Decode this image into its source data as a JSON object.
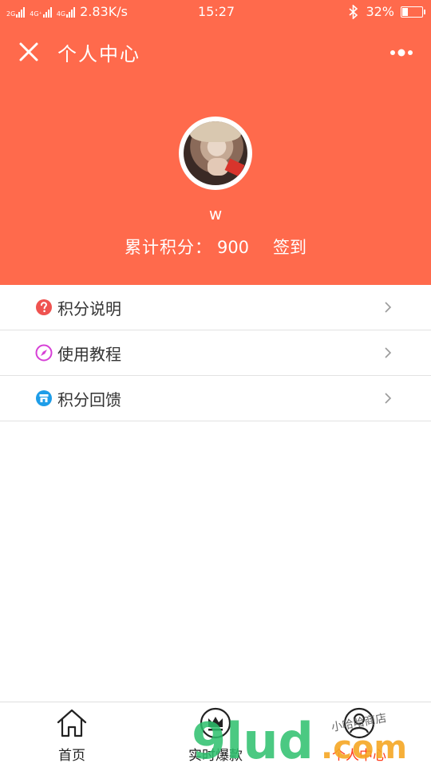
{
  "status_bar": {
    "net1": "2G",
    "net2": "4G⁺",
    "net3": "4G",
    "speed": "2.83K/s",
    "time": "15:27",
    "battery_percent": "32%",
    "battery_level": 0.32
  },
  "navbar": {
    "title": "个人中心"
  },
  "profile": {
    "username": "w",
    "points_label": "累计积分：",
    "points_value": "900",
    "signin_label": "签到"
  },
  "menu": {
    "items": [
      {
        "label": "积分说明",
        "icon": "question-icon",
        "color": "#ef5350"
      },
      {
        "label": "使用教程",
        "icon": "compass-icon",
        "color": "#d63fd6"
      },
      {
        "label": "积分回馈",
        "icon": "shop-icon",
        "color": "#1e9de8"
      }
    ]
  },
  "tabbar": {
    "tabs": [
      {
        "label": "首页",
        "icon": "home-icon",
        "active": false
      },
      {
        "label": "实时爆款",
        "icon": "crown-icon",
        "active": false
      },
      {
        "label": "个人中心",
        "icon": "user-icon",
        "active": true
      }
    ]
  },
  "watermark": {
    "text": "9lud.com",
    "subtext": "小哈哈商店"
  },
  "colors": {
    "header_bg": "#ff6a4c",
    "active_tab": "#ff3a1a",
    "watermark_green": "#2bbf6c",
    "watermark_orange": "#f5a623"
  }
}
